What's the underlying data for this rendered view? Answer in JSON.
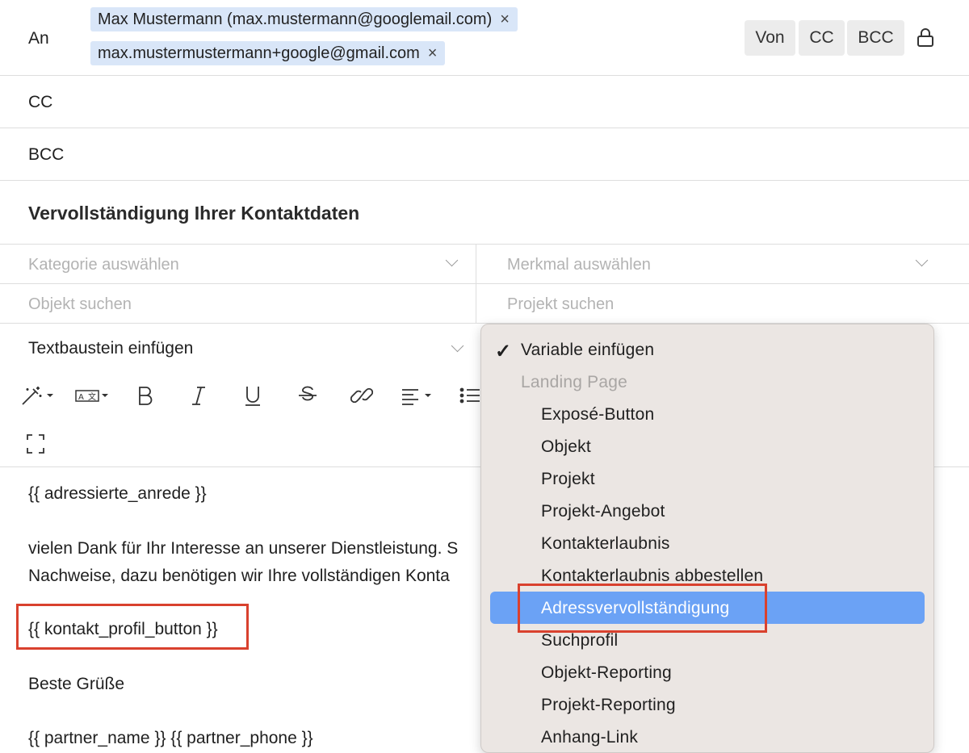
{
  "header": {
    "to_label": "An",
    "recipients": [
      {
        "text": "Max Mustermann (max.mustermann@googlemail.com)"
      },
      {
        "text": "max.mustermustermann+google@gmail.com"
      }
    ],
    "remove_glyph": "×",
    "buttons": {
      "von": "Von",
      "cc": "CC",
      "bcc": "BCC"
    }
  },
  "cc_label": "CC",
  "bcc_label": "BCC",
  "subject": "Vervollständigung Ihrer Kontaktdaten",
  "fields": {
    "category_placeholder": "Kategorie auswählen",
    "feature_placeholder": "Merkmal auswählen",
    "object_placeholder": "Objekt suchen",
    "project_placeholder": "Projekt suchen",
    "text_block": "Textbaustein einfügen"
  },
  "editor": {
    "lines": {
      "salutation": "{{ adressierte_anrede }}",
      "para1_line1": "vielen Dank für Ihr Interesse an unserer Dienstleistung. S",
      "para1_line2": "Nachweise, dazu benötigen wir Ihre vollständigen Konta",
      "button_var": "{{ kontakt_profil_button }}",
      "closing": "Beste Grüße",
      "signature": "{{ partner_name }} {{ partner_phone }}"
    }
  },
  "variable_menu": {
    "checkmark": "✓",
    "title": "Variable einfügen",
    "group": "Landing Page",
    "items": [
      "Exposé-Button",
      "Objekt",
      "Projekt",
      "Projekt-Angebot",
      "Kontakterlaubnis",
      "Kontakterlaubnis abbestellen",
      "Adressvervollständigung",
      "Suchprofil",
      "Objekt-Reporting",
      "Projekt-Reporting",
      "Anhang-Link"
    ],
    "selected_index": 6,
    "selected_color": "#6ba2f5"
  },
  "colors": {
    "chip_bg": "#d9e6f8",
    "highlight_border": "#d9412e",
    "menu_bg": "#ebe6e3"
  },
  "icons": [
    "magic-wand-icon",
    "translate-icon",
    "bold-icon",
    "italic-icon",
    "underline-icon",
    "strikethrough-icon",
    "link-icon",
    "align-icon",
    "bullet-list-icon",
    "fullscreen-icon",
    "lock-icon",
    "chevron-down-icon",
    "checkmark-icon"
  ]
}
